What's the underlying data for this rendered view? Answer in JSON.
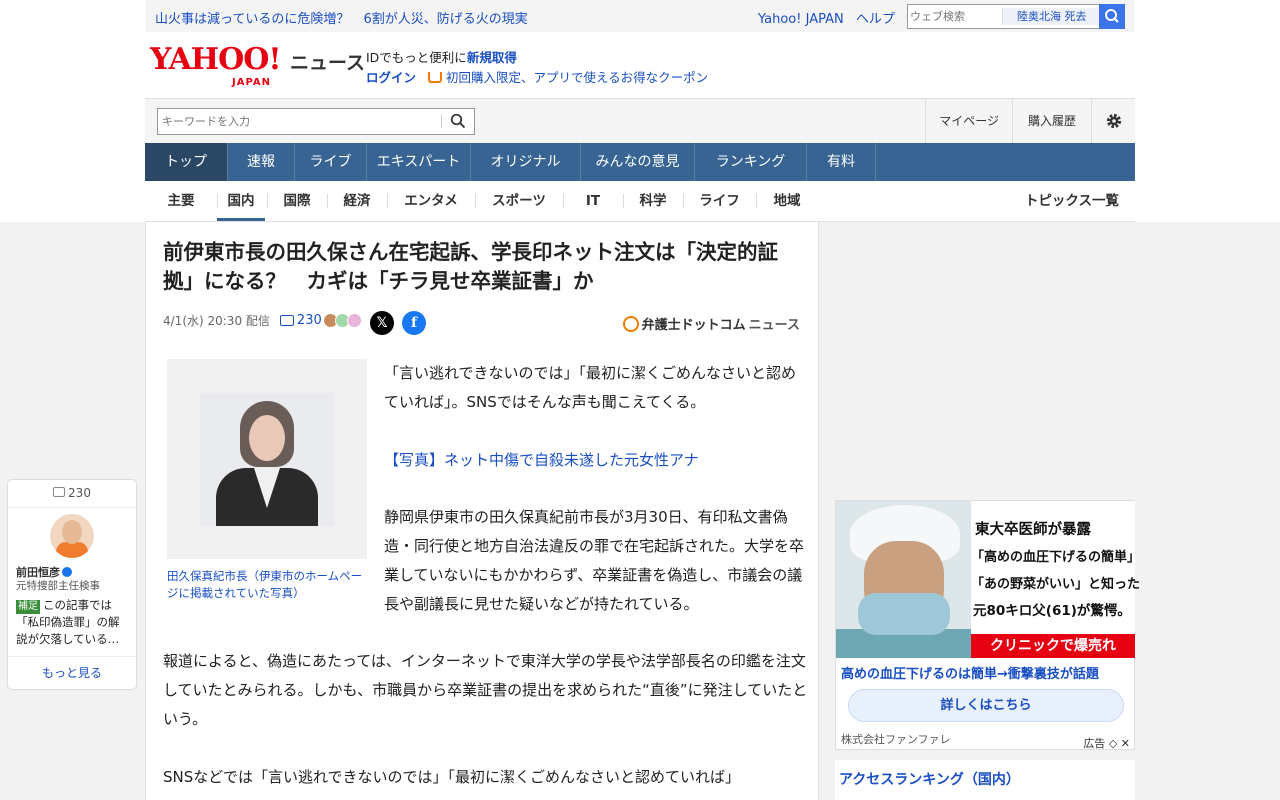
{
  "top_bar": {
    "headline_1": "山火事は減っているのに危険増？",
    "headline_2": "6割が人災、防げる火の現実",
    "yahoo_japan": "Yahoo! JAPAN",
    "help": "ヘルプ",
    "search_placeholder": "ウェブ検索",
    "trending": "陸奥北海 死去"
  },
  "logo": {
    "brand": "YAHOO!",
    "sub": "JAPAN",
    "service": "ニュース"
  },
  "id_promo": {
    "text": "IDでもっと便利に",
    "signup": "新規取得",
    "login": "ログイン",
    "coupon": "初回購入限定、アプリで使えるお得なクーポン"
  },
  "search": {
    "placeholder": "キーワードを入力"
  },
  "account_links": {
    "mypage": "マイページ",
    "history": "購入履歴"
  },
  "main_nav": [
    {
      "label": "トップ",
      "active": true
    },
    {
      "label": "速報"
    },
    {
      "label": "ライブ"
    },
    {
      "label": "エキスパート"
    },
    {
      "label": "オリジナル"
    },
    {
      "label": "みんなの意見"
    },
    {
      "label": "ランキング"
    },
    {
      "label": "有料"
    }
  ],
  "sub_nav": [
    {
      "label": "主要"
    },
    {
      "label": "国内",
      "active": true
    },
    {
      "label": "国際"
    },
    {
      "label": "経済"
    },
    {
      "label": "エンタメ"
    },
    {
      "label": "スポーツ"
    },
    {
      "label": "IT"
    },
    {
      "label": "科学"
    },
    {
      "label": "ライフ"
    },
    {
      "label": "地域"
    }
  ],
  "sub_nav_all": "トピックス一覧",
  "article": {
    "title": "前伊東市長の田久保さん在宅起訴、学長印ネット注文は「決定的証拠」になる？　カギは「チラ見せ卒業証書」か",
    "date": "4/1(水) 20:30",
    "delivered": "配信",
    "comment_count": "230",
    "provider": "弁護士ドットコム",
    "provider_suffix": "ニュース",
    "photo_caption": "田久保真紀市長（伊東市のホームページに掲載されていた写真）",
    "p1": "「言い逃れできないのでは」「最初に潔くごめんなさいと認めていれば」。SNSではそんな声も聞こえてくる。",
    "photo_link": "【写真】ネット中傷で自殺未遂した元女性アナ",
    "p2": "静岡県伊東市の田久保真紀前市長が3月30日、有印私文書偽造・同行使と地方自治法違反の罪で在宅起訴された。大学を卒業していないにもかかわらず、卒業証書を偽造し、市議会の議長や副議長に見せた疑いなどが持たれている。",
    "p3": "報道によると、偽造にあたっては、インターネットで東洋大学の学長や法学部長名の印鑑を注文していたとみられる。しかも、市職員から卒業証書の提出を求められた“直後”に発注していたという。",
    "p4": "SNSなどでは「言い逃れできないのでは」「最初に潔くごめんなさいと認めていれば」"
  },
  "comment_widget": {
    "count": "230",
    "name": "前田恒彦",
    "role": "元特捜部主任検事",
    "tag": "補足",
    "text": "この記事では「私印偽造罪」の解説が欠落している…",
    "more": "もっと見る"
  },
  "ad": {
    "line1": "東大卒医師が暴露",
    "line2": "「高めの血圧下げるの簡単」",
    "line3": "「あの野菜がいい」と知った",
    "line4": "元80キロ父(61)が驚愕。",
    "red_banner": "クリニックで爆売れ",
    "headline": "高めの血圧下げるのは簡単→衝撃裏技が話題",
    "cta": "詳しくはこちら",
    "sponsor": "株式会社ファンファレ",
    "label": "広告"
  },
  "ranking": {
    "title": "アクセスランキング（国内）"
  },
  "colors": {
    "nav": "#376492",
    "nav_active": "#2a4765",
    "link": "#1a4fc4",
    "brand_red": "#e60012"
  }
}
